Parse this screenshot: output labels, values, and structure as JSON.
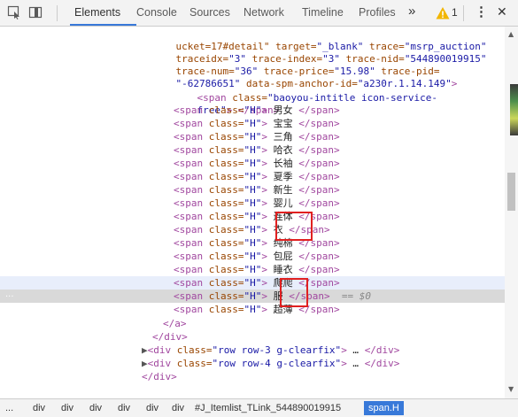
{
  "toolbar": {
    "tabs": [
      "Elements",
      "Console",
      "Sources",
      "Network",
      "Timeline",
      "Profiles"
    ],
    "more": "»",
    "warning_count": "1",
    "menu": "⋮",
    "close": "✕"
  },
  "code": {
    "line1": {
      "a1": "ucket=17#detail\"",
      "b1": " target=",
      "c1": "\"_blank\"",
      "d1": " trace=",
      "e1": "\"msrp_auction\""
    },
    "line2": {
      "a": "traceidx=",
      "b": "\"3\"",
      "c": " trace-index=",
      "d": "\"3\"",
      "e": " trace-nid=",
      "f": "\"544890019915\""
    },
    "line3": {
      "a": "trace-num=",
      "b": "\"36\"",
      "c": " trace-price=",
      "d": "\"15.98\"",
      "e": " trace-pid="
    },
    "line4": {
      "a": "\"-62786651\"",
      "b": " data-spm-anchor-id=",
      "c": "\"a230r.1.14.149\"",
      "d": ">"
    },
    "line5": {
      "a": "<span",
      "b": " class=",
      "c": "\"baoyou-intitle icon-service-"
    },
    "line6": {
      "a": "free\"",
      "b": "> </span>"
    },
    "span_open": "<span",
    "class_attr": " class=",
    "h_val": "\"H\"",
    "gt": ">",
    "close_tag": "</span>",
    "items": [
      "男女",
      "宝宝",
      "三角",
      "哈衣",
      "长袖",
      "夏季",
      "新生",
      "婴儿",
      "连体",
      "衣",
      "纯棉",
      "包屁",
      "睡衣",
      "爬爬",
      "服",
      "超薄"
    ],
    "selected_marker": "== $0",
    "a_close": "</a>",
    "div_close": "</div>",
    "div_row3": {
      "open": "<div",
      "cls": " class=",
      "val": "\"row row-3 g-clearfix\"",
      "rest": ">",
      "ell": " … ",
      "close": "</div>"
    },
    "div_row4": {
      "open": "<div",
      "cls": " class=",
      "val": "\"row row-4 g-clearfix\"",
      "rest": ">",
      "ell": " … ",
      "close": "</div>"
    },
    "div_close2": "</div>",
    "gutter_dots": "..."
  },
  "breadcrumb": {
    "ellipsis": "...",
    "items": [
      "div",
      "div",
      "div",
      "div",
      "div",
      "div",
      "div"
    ],
    "link": "#J_Itemlist_TLink_544890019915",
    "active": "span.H"
  }
}
